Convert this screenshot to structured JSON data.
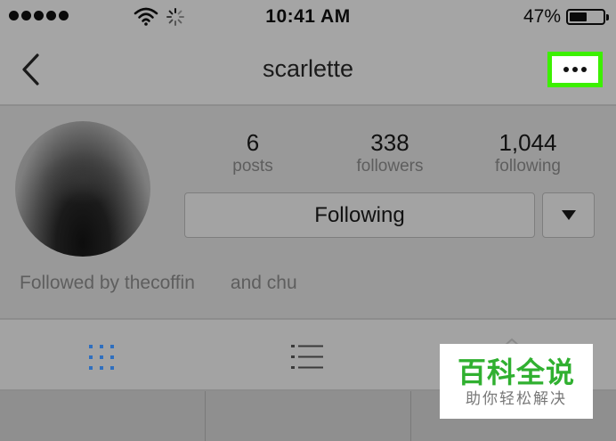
{
  "status_bar": {
    "time": "10:41 AM",
    "battery_percent": "47%",
    "battery_level": 0.47,
    "signal_dots": 5,
    "icons": [
      "wifi-icon",
      "loading-spinner-icon",
      "battery-icon"
    ]
  },
  "nav": {
    "title": "scarlette",
    "back_icon": "chevron-left-icon",
    "more_icon": "ellipsis-icon",
    "highlight_color": "#3cf000"
  },
  "profile": {
    "stats": [
      {
        "value": "6",
        "label": "posts"
      },
      {
        "value": "338",
        "label": "followers"
      },
      {
        "value": "1,044",
        "label": "following"
      }
    ],
    "following_button": "Following",
    "dropdown_icon": "triangle-down-icon",
    "followed_by": "Followed by thecoffin",
    "followed_by_more": "and chu"
  },
  "tabs": [
    "grid-view-icon",
    "list-view-icon",
    "tagged-icon"
  ],
  "watermark": {
    "title": "百科全说",
    "subtitle": "助你轻松解决",
    "color": "#30b030"
  }
}
